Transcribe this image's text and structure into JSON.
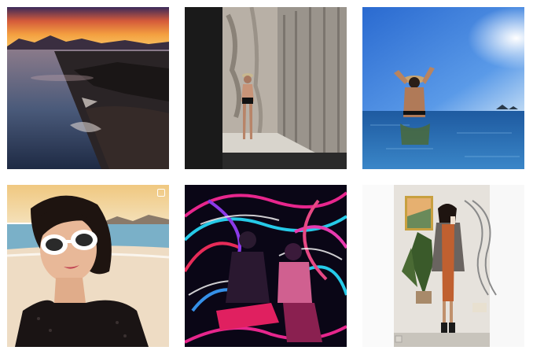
{
  "grid": {
    "posts": [
      {
        "id": "post-sunset-coast"
      },
      {
        "id": "post-stone-corridor"
      },
      {
        "id": "post-infinity-pool"
      },
      {
        "id": "post-beach-selfie",
        "multi_image": true
      },
      {
        "id": "post-light-painting"
      },
      {
        "id": "post-mirror-selfie"
      }
    ]
  }
}
